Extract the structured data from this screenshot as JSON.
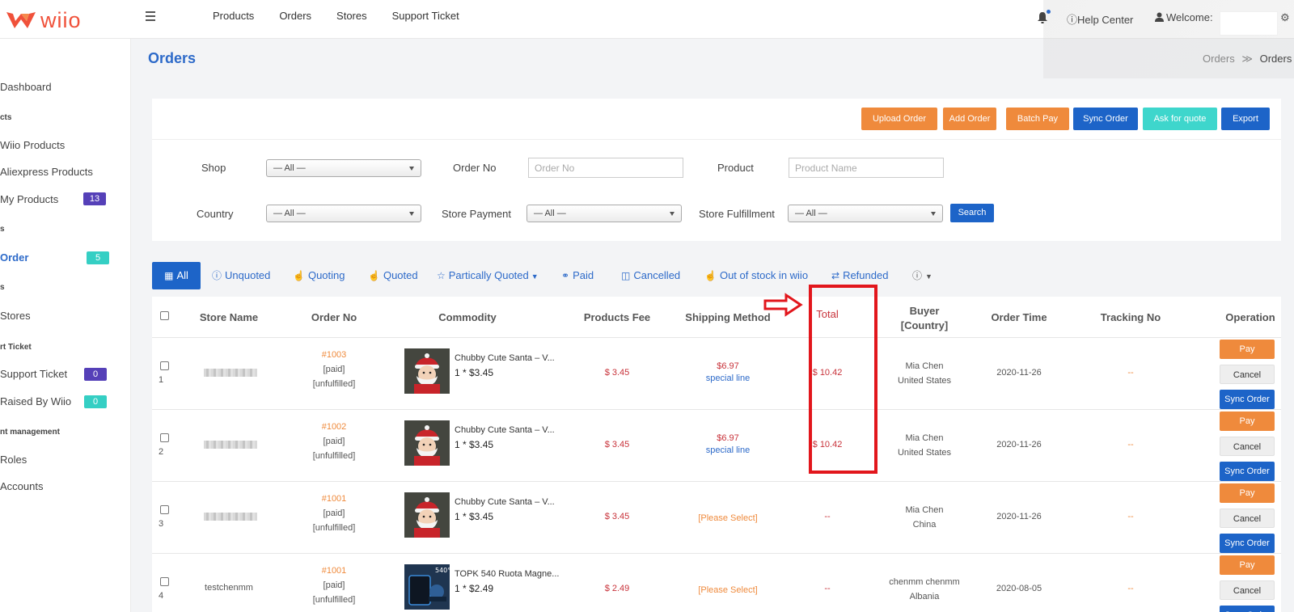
{
  "brand": {
    "logo_text": "wiio",
    "accent": "#f0513a",
    "primary": "#2d6ac9"
  },
  "topnav": {
    "items": [
      "Products",
      "Orders",
      "Stores",
      "Support Ticket"
    ]
  },
  "topright": {
    "help": "Help  Center",
    "welcome": "Welcome:"
  },
  "sidebar": {
    "dashboard": "Dashboard",
    "group_products": "cts",
    "wiio_products": "Wiio Products",
    "aliexpress_products": "Aliexpress Products",
    "my_products": "My Products",
    "my_products_count": "13",
    "group_orders": "s",
    "order": "Order",
    "order_count": "5",
    "group_stores": "s",
    "stores": "Stores",
    "group_ticket": "rt Ticket",
    "support_ticket": "Support Ticket",
    "support_ticket_count": "0",
    "raised_by_wiio": "Raised By Wiio",
    "raised_by_wiio_count": "0",
    "group_account": "nt management",
    "roles": "Roles",
    "accounts": "Accounts"
  },
  "page": {
    "title": "Orders",
    "breadcrumb_parent": "Orders",
    "breadcrumb_sep": "≫",
    "breadcrumb_current": "Orders"
  },
  "actions": {
    "upload_order": "Upload Order",
    "add_order": "Add Order",
    "batch_pay": "Batch Pay",
    "sync_order": "Sync Order",
    "ask_for_quote": "Ask for quote",
    "export": "Export"
  },
  "filters": {
    "shop_label": "Shop",
    "shop_value": "— All —",
    "order_no_label": "Order No",
    "order_no_placeholder": "Order No",
    "product_label": "Product",
    "product_placeholder": "Product Name",
    "country_label": "Country",
    "country_value": "— All —",
    "store_payment_label": "Store Payment",
    "store_payment_value": "— All —",
    "store_fulfillment_label": "Store Fulfillment",
    "store_fulfillment_value": "— All —",
    "search": "Search"
  },
  "tabs": {
    "all": "All",
    "unquoted": "Unquoted",
    "quoting": "Quoting",
    "quoted": "Quoted",
    "partially_quoted": "Partically Quoted",
    "paid": "Paid",
    "cancelled": "Cancelled",
    "out_of_stock": "Out of stock in wiio",
    "refunded": "Refunded"
  },
  "table": {
    "headers": {
      "store_name": "Store Name",
      "order_no": "Order No",
      "commodity": "Commodity",
      "products_fee": "Products Fee",
      "shipping_method": "Shipping Method",
      "total": "Total",
      "buyer_line1": "Buyer",
      "buyer_line2": "[Country]",
      "order_time": "Order Time",
      "tracking_no": "Tracking No",
      "operation": "Operation"
    },
    "rows": [
      {
        "index": "1",
        "store": "",
        "order_no": "#1003",
        "payment": "[paid]",
        "fulfillment": "[unfulfilled]",
        "product": "Chubby Cute Santa – V...",
        "qty": "1 * $3.45",
        "fee": "$ 3.45",
        "ship_price": "$6.97",
        "ship_name": "special line",
        "total": "$ 10.42",
        "buyer": "Mia Chen",
        "country": "United States",
        "time": "2020-11-26",
        "tracking": "--"
      },
      {
        "index": "2",
        "store": "",
        "order_no": "#1002",
        "payment": "[paid]",
        "fulfillment": "[unfulfilled]",
        "product": "Chubby Cute Santa – V...",
        "qty": "1 * $3.45",
        "fee": "$ 3.45",
        "ship_price": "$6.97",
        "ship_name": "special line",
        "total": "$ 10.42",
        "buyer": "Mia Chen",
        "country": "United States",
        "time": "2020-11-26",
        "tracking": "--"
      },
      {
        "index": "3",
        "store": "",
        "order_no": "#1001",
        "payment": "[paid]",
        "fulfillment": "[unfulfilled]",
        "product": "Chubby Cute Santa – V...",
        "qty": "1 * $3.45",
        "fee": "$ 3.45",
        "ship_select": "[Please Select]",
        "total": "--",
        "buyer": "Mia Chen",
        "country": "China",
        "time": "2020-11-26",
        "tracking": "--"
      },
      {
        "index": "4",
        "store": "testchenmm",
        "order_no": "#1001",
        "payment": "[paid]",
        "fulfillment": "[unfulfilled]",
        "product": "TOPK 540 Ruota Magne...",
        "qty": "1 * $2.49",
        "fee": "$ 2.49",
        "ship_select": "[Please Select]",
        "total": "--",
        "buyer": "chenmm chenmm",
        "country": "Albania",
        "time": "2020-08-05",
        "tracking": "--"
      }
    ],
    "op": {
      "pay": "Pay",
      "cancel": "Cancel",
      "sync": "Sync Order"
    },
    "thumb_badge": "540°"
  },
  "icons": [
    "hamburger-icon",
    "bell-icon",
    "help-icon",
    "user-icon",
    "gear-icon",
    "grid-icon",
    "question-icon",
    "hand-icon",
    "star-icon",
    "handshake-icon",
    "trash-icon",
    "shuffle-icon",
    "info-icon",
    "caret-down-icon",
    "red-arrow-icon"
  ]
}
